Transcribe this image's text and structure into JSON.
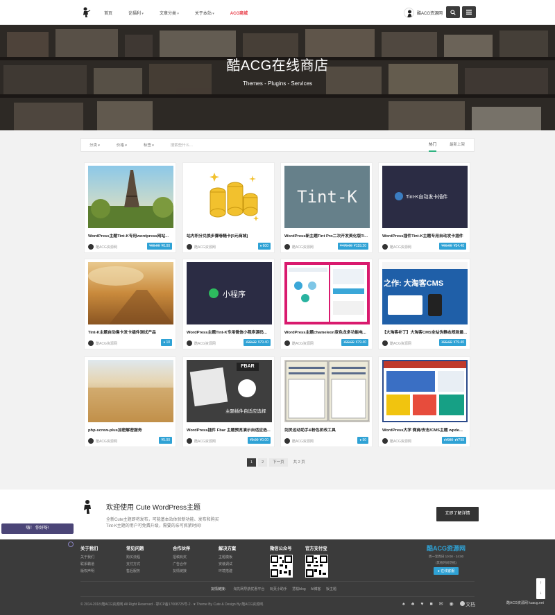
{
  "header": {
    "nav": [
      {
        "label": "首页",
        "dropdown": false,
        "accent": false
      },
      {
        "label": "论福利",
        "dropdown": true,
        "accent": false
      },
      {
        "label": "文章分类",
        "dropdown": true,
        "accent": false
      },
      {
        "label": "关于本站",
        "dropdown": true,
        "accent": false
      },
      {
        "label": "ACG商城",
        "dropdown": false,
        "accent": true
      }
    ],
    "username": "酷ACG资源网",
    "search_icon": "search-icon",
    "menu_icon": "menu-icon"
  },
  "hero": {
    "title": "酷ACG在线商店",
    "subtitle": "Themes - Plugins - Services"
  },
  "filter": {
    "dropdowns": [
      "分类",
      "价格",
      "标签"
    ],
    "search_placeholder": "搜索些什么...",
    "sort": [
      "热门",
      "最新上架"
    ],
    "active_sort": "热门"
  },
  "products": [
    {
      "title": "WordPress主题Tint-K专用wordpress网站...",
      "author": "酷ACG资源网",
      "price_old": "¥60.00",
      "price": "¥0.00",
      "type": "money"
    },
    {
      "title": "站内积分兑换步骤卷糙卡[5元商城]",
      "author": "酷ACG资源网",
      "price": "600",
      "type": "credit"
    },
    {
      "title": "WordPress新主题Tint Pro二次开发美化版Ti...",
      "author": "酷ACG资源网",
      "price_old": "¥479.00",
      "price": "¥159.20",
      "type": "money"
    },
    {
      "title": "WordPress插件Tint-K主题专用自动发卡插件",
      "author": "酷ACG资源网",
      "price_old": "¥69.00",
      "price": "¥54.40",
      "type": "money"
    },
    {
      "title": "Tint-K主题自动售卡发卡插件测试产品",
      "author": "酷ACG资源网",
      "price": "10",
      "type": "credit"
    },
    {
      "title": "WordPress主题Tint-K专用微信小程序源码...",
      "author": "酷ACG资源网",
      "price_old": "¥99.00",
      "price": "¥79.40",
      "type": "money"
    },
    {
      "title": "WordPress主题chameleon变色龙多功能电...",
      "author": "酷ACG资源网",
      "price_old": "¥99.00",
      "price": "¥79.40",
      "type": "money"
    },
    {
      "title": "【大淘客补丁】大淘客CMS全站伪静态规则最...",
      "author": "酷ACG资源网",
      "price_old": "¥99.00",
      "price": "¥79.40",
      "type": "money"
    },
    {
      "title": "php-screw-plus加密解密服务",
      "author": "酷ACG资源网",
      "price": "¥5.00",
      "type": "money"
    },
    {
      "title": "WordPress插件 Fbar 主题预览演示自适应选...",
      "author": "酷ACG资源网",
      "price_old": "¥0.00",
      "price": "¥0.00",
      "type": "money"
    },
    {
      "title": "剑灵远动助手&粉色桥改工具",
      "author": "酷ACG资源网",
      "price": "50",
      "type": "credit"
    },
    {
      "title": "WordPress大学 微商/安志/CMS主题 wpde...",
      "author": "酷ACG资源网",
      "price_old": "¥980",
      "price": "¥798",
      "type": "credit2"
    }
  ],
  "thumbnails": {
    "tintk_text": "Tint-K",
    "plugin_text": "Tint-K自动发卡插件",
    "mini_text": "小程序",
    "fbar_text": "FBAR",
    "fbar_sub": "主题插件自适应选择",
    "cms_text": "之作: 大淘客CMS"
  },
  "pagination": {
    "pages": [
      "1",
      "2"
    ],
    "next": "下一页",
    "total": "共 2 页",
    "current": "1"
  },
  "promo": {
    "title": "欢迎使用 Cute WordPress主题",
    "line1": "全新Cute主题即将发布，可能基本站体验新功能、发布和购买",
    "line2": "Tint-K主题的用户可免费升级，需要的亲可抓紧时间!",
    "button": "立即了解详情"
  },
  "toast": "嗨！ 你好呀!",
  "footer": {
    "columns": [
      {
        "heading": "关于我们",
        "links": [
          "关于我们",
          "联系霸道",
          "版权声明"
        ]
      },
      {
        "heading": "常见问题",
        "links": [
          "购买流程",
          "支付方式",
          "售后服务"
        ]
      },
      {
        "heading": "合作伙伴",
        "links": [
          "招稿有奖",
          "广告合作",
          "友情链接"
        ]
      },
      {
        "heading": "解决方案",
        "links": [
          "主题模板",
          "安装调试",
          "环境搭建"
        ]
      }
    ],
    "wechat_heading": "微信公众号",
    "alipay_heading": "官方支付宝",
    "brand": {
      "name": "酷ACG资源网",
      "hours": "周一至周日 10:00 - 24:00",
      "note": "(其他时间勿扰)",
      "service_button": "在线客服"
    },
    "links_label": "友情链接：",
    "friend_links": [
      "淘先网导航优惠平台",
      "玩芙小助手",
      "慧桜blog",
      "AI博客",
      "饭主题"
    ],
    "copyright": "© 2014-2018 酷ACG资源网 All Right Reserved · 鄂ICP备17008725号-2 · ♥ Theme By Cute & Design By 酷ACG资源网.",
    "lang": "文档",
    "watermark": "酷ACG资源网 kuacg.net"
  },
  "colors": {
    "accent": "#2fa2d5",
    "green": "#2fb380",
    "red": "#e83b46",
    "dark": "#3b3b3b"
  }
}
